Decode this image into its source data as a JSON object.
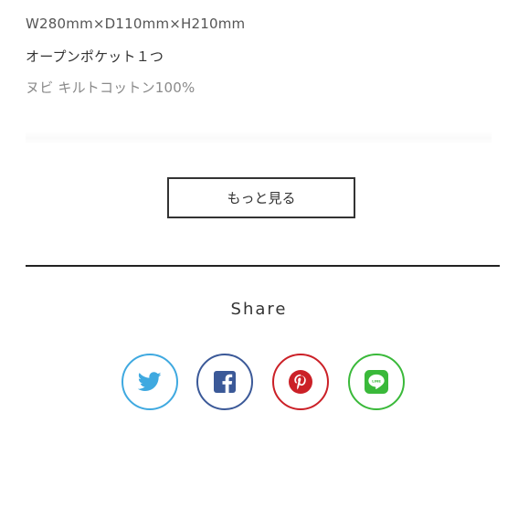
{
  "product_specs": [
    "W280mm×D110mm×H210mm",
    "オープンポケット１つ",
    "ヌビ キルトコットン100%"
  ],
  "more_button": {
    "label": "もっと見る"
  },
  "share": {
    "title": "Share",
    "buttons": [
      {
        "name": "twitter",
        "icon": "twitter-bird-icon",
        "color": "#3fa9e0"
      },
      {
        "name": "facebook",
        "icon": "facebook-f-icon",
        "color": "#3b5998"
      },
      {
        "name": "pinterest",
        "icon": "pinterest-p-icon",
        "color": "#cb2027"
      },
      {
        "name": "line",
        "icon": "line-chat-icon",
        "color": "#3ab93a"
      }
    ]
  }
}
